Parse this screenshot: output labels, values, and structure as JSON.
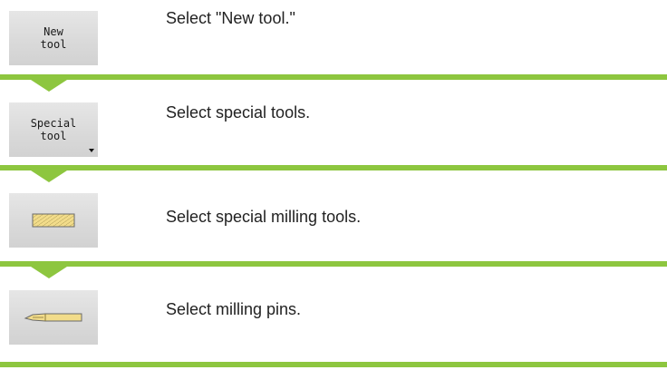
{
  "colors": {
    "accent_green": "#8dc63f",
    "softkey_bg": "#dadada",
    "text": "#222222"
  },
  "steps": [
    {
      "softkey_label": "New\ntool",
      "softkey_icon": null,
      "has_dropdown": false,
      "instruction": "Select \"New tool.\""
    },
    {
      "softkey_label": "Special\ntool",
      "softkey_icon": null,
      "has_dropdown": true,
      "instruction": "Select special tools."
    },
    {
      "softkey_label": "",
      "softkey_icon": "special-milling-tool-icon",
      "has_dropdown": false,
      "instruction": "Select special milling tools."
    },
    {
      "softkey_label": "",
      "softkey_icon": "milling-pin-icon",
      "has_dropdown": false,
      "instruction": "Select milling pins."
    }
  ]
}
